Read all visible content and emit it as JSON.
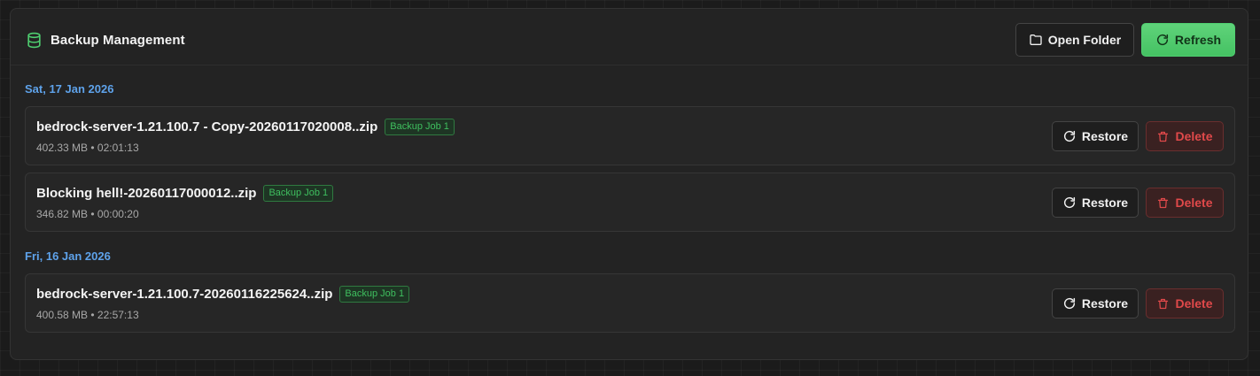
{
  "header": {
    "title": "Backup Management",
    "open_folder_label": "Open Folder",
    "refresh_label": "Refresh"
  },
  "colors": {
    "accent_green": "#4fcf70",
    "date_blue": "#5ea2ea",
    "delete_red": "#e0494a"
  },
  "groups": [
    {
      "date": "Sat, 17 Jan 2026",
      "items": [
        {
          "name": "bedrock-server-1.21.100.7 - Copy-20260117020008..zip",
          "job": "Backup Job 1",
          "meta": "402.33 MB • 02:01:13",
          "restore_label": "Restore",
          "delete_label": "Delete"
        },
        {
          "name": "Blocking hell!-20260117000012..zip",
          "job": "Backup Job 1",
          "meta": "346.82 MB • 00:00:20",
          "restore_label": "Restore",
          "delete_label": "Delete"
        }
      ]
    },
    {
      "date": "Fri, 16 Jan 2026",
      "items": [
        {
          "name": "bedrock-server-1.21.100.7-20260116225624..zip",
          "job": "Backup Job 1",
          "meta": "400.58 MB • 22:57:13",
          "restore_label": "Restore",
          "delete_label": "Delete"
        }
      ]
    }
  ]
}
